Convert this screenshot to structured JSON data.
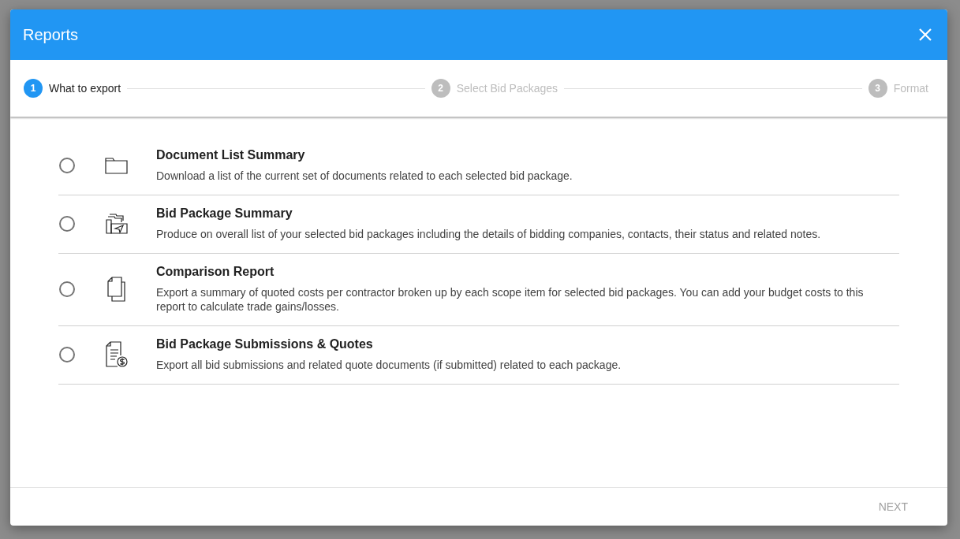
{
  "dialog": {
    "title": "Reports"
  },
  "steps": [
    {
      "number": "1",
      "label": "What to export",
      "selected": true
    },
    {
      "number": "2",
      "label": "Select Bid Packages",
      "selected": false
    },
    {
      "number": "3",
      "label": "Format",
      "selected": false
    }
  ],
  "options": [
    {
      "kind": "folder",
      "title": "Document List Summary",
      "description": "Download a list of the current set of documents related to each selected bid package.",
      "selected": false
    },
    {
      "kind": "package",
      "title": "Bid Package Summary",
      "description": "Produce on overall list of your selected bid packages including the details of bidding companies, contacts, their status and related notes.",
      "selected": false
    },
    {
      "kind": "pages",
      "title": "Comparison Report",
      "description": "Export a summary of quoted costs per contractor broken up by each scope item for selected bid packages. You can add your budget costs to this report to calculate trade gains/losses.",
      "selected": false
    },
    {
      "kind": "invoice",
      "title": "Bid Package Submissions & Quotes",
      "description": "Export all bid submissions and related quote documents (if submitted) related to each package.",
      "selected": false
    }
  ],
  "footer": {
    "next": {
      "label": "NEXT",
      "disabled": true
    }
  }
}
